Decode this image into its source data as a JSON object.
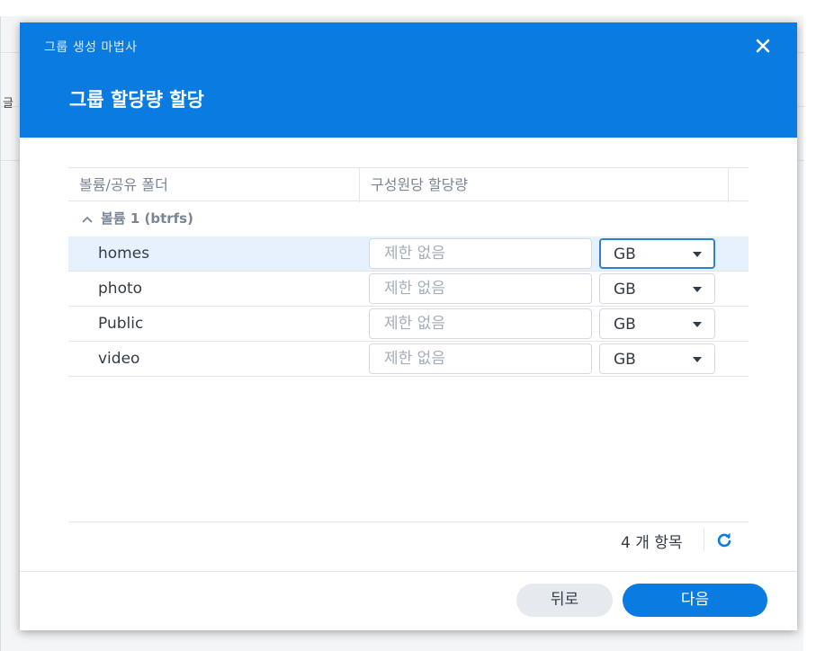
{
  "background": {
    "partial_char": "글"
  },
  "dialog": {
    "wizard_title": "그룹 생성 마법사",
    "step_title": "그룹 할당량 할당",
    "close_icon": "close-icon"
  },
  "table": {
    "headers": [
      "볼륨/공유 폴더",
      "구성원당 할당량"
    ],
    "group_label": "볼륨 1 (btrfs)",
    "rows": [
      {
        "name": "homes",
        "quota_placeholder": "제한 없음",
        "unit": "GB"
      },
      {
        "name": "photo",
        "quota_placeholder": "제한 없음",
        "unit": "GB"
      },
      {
        "name": "Public",
        "quota_placeholder": "제한 없음",
        "unit": "GB"
      },
      {
        "name": "video",
        "quota_placeholder": "제한 없음",
        "unit": "GB"
      }
    ]
  },
  "footer": {
    "item_count": "4 개 항목"
  },
  "buttons": {
    "back": "뒤로",
    "next": "다음"
  },
  "colors": {
    "accent": "#0a7be0",
    "selected_row": "#e6f1fd"
  }
}
